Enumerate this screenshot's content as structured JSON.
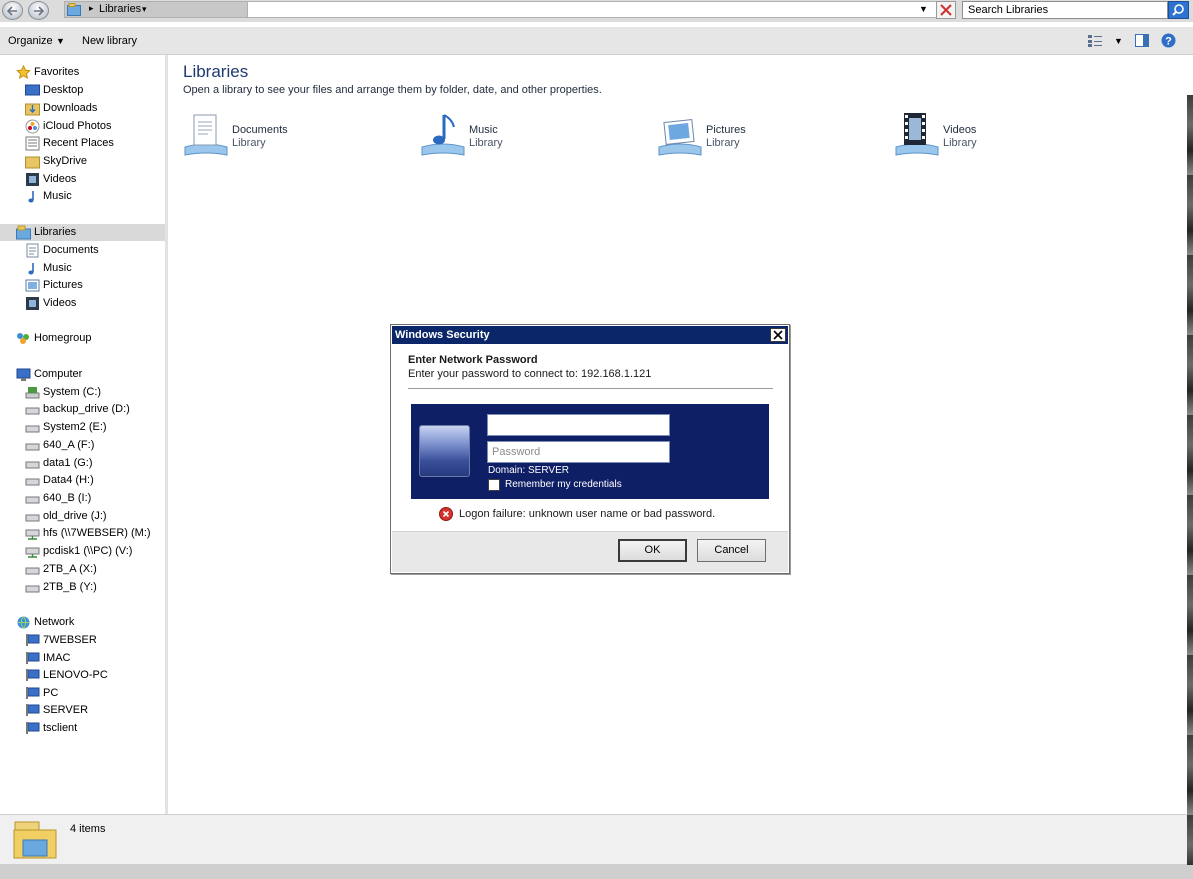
{
  "address_bar": {
    "path": "Libraries",
    "search_placeholder": "Search Libraries"
  },
  "toolbar": {
    "organize_label": "Organize",
    "new_library_label": "New library"
  },
  "nav": {
    "favorites": {
      "label": "Favorites",
      "items": [
        "Desktop",
        "Downloads",
        "iCloud Photos",
        "Recent Places",
        "SkyDrive",
        "Videos",
        "Music"
      ]
    },
    "libraries": {
      "label": "Libraries",
      "items": [
        "Documents",
        "Music",
        "Pictures",
        "Videos"
      ]
    },
    "homegroup": {
      "label": "Homegroup"
    },
    "computer": {
      "label": "Computer",
      "items": [
        "System (C:)",
        "backup_drive (D:)",
        "System2 (E:)",
        "640_A (F:)",
        "data1 (G:)",
        "Data4 (H:)",
        "640_B (I:)",
        "old_drive (J:)",
        "hfs (\\\\7WEBSER) (M:)",
        "pcdisk1 (\\\\PC) (V:)",
        "2TB_A (X:)",
        "2TB_B (Y:)"
      ]
    },
    "network": {
      "label": "Network",
      "items": [
        "7WEBSER",
        "IMAC",
        "LENOVO-PC",
        "PC",
        "SERVER",
        "tsclient"
      ]
    }
  },
  "content": {
    "title": "Libraries",
    "subtitle": "Open a library to see your files and arrange them by folder, date, and other properties.",
    "libraries": [
      {
        "name": "Documents",
        "type": "Library",
        "icon": "documents-library-icon"
      },
      {
        "name": "Music",
        "type": "Library",
        "icon": "music-library-icon"
      },
      {
        "name": "Pictures",
        "type": "Library",
        "icon": "pictures-library-icon"
      },
      {
        "name": "Videos",
        "type": "Library",
        "icon": "videos-library-icon"
      }
    ]
  },
  "status": {
    "count": "4 items"
  },
  "dialog": {
    "title": "Windows Security",
    "heading": "Enter Network Password",
    "prompt": "Enter your password to connect to: 192.168.1.121",
    "username_value": "",
    "password_placeholder": "Password",
    "domain": "Domain: SERVER",
    "remember_label": "Remember my credentials",
    "remember_checked": false,
    "error": "Logon failure: unknown user name or bad password.",
    "ok_label": "OK",
    "cancel_label": "Cancel"
  },
  "colors": {
    "dialog_titlebar": "#0b2669",
    "credential_panel": "#0f1f66",
    "title_text": "#1e3a6e",
    "error_red": "#d8312b"
  }
}
